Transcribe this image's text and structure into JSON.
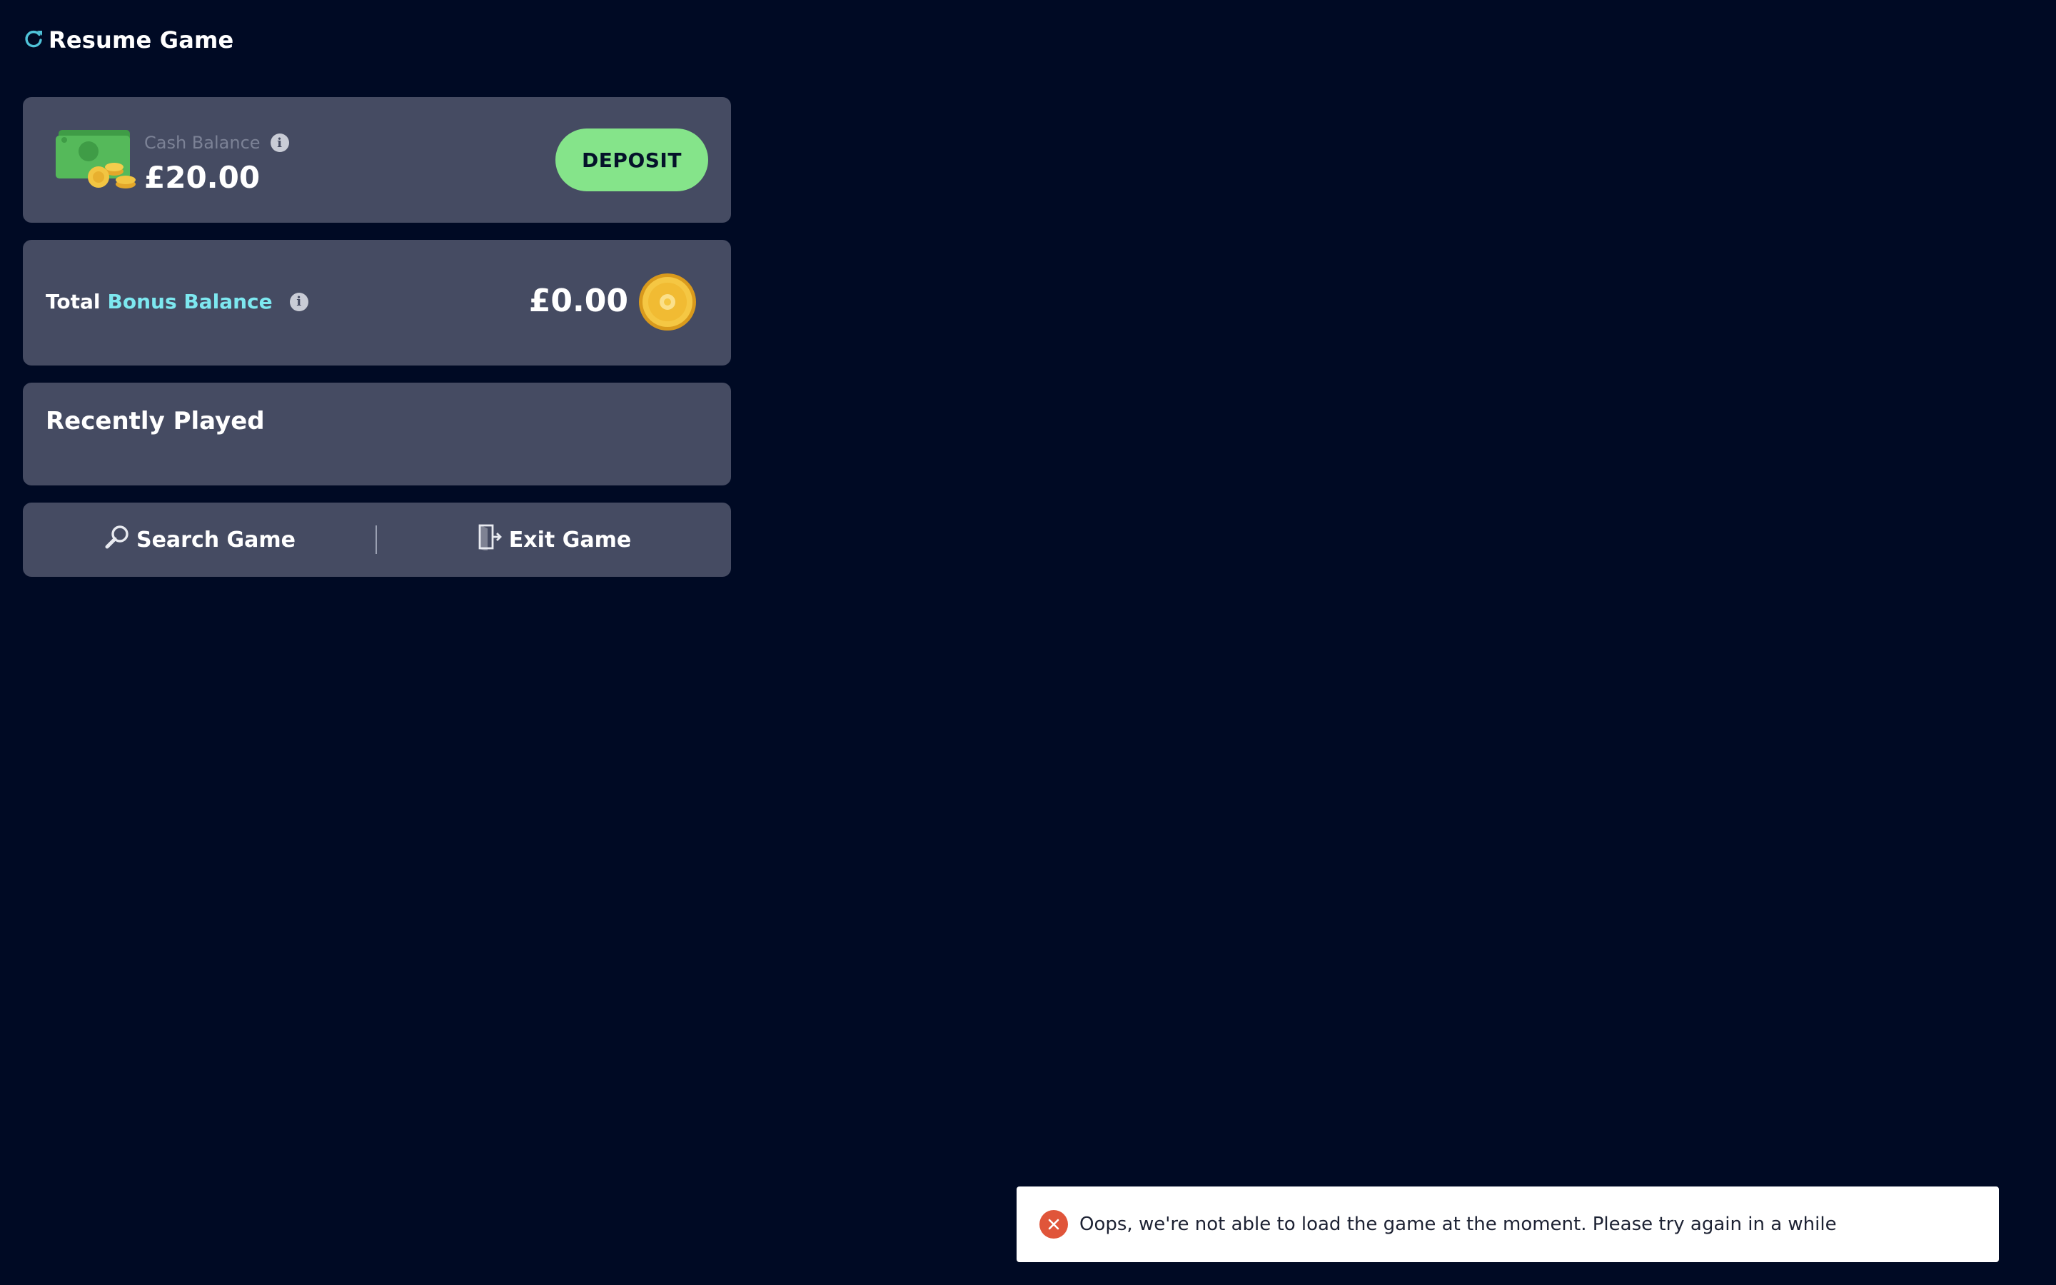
{
  "header": {
    "title": "Resume Game",
    "icon": "refresh-icon",
    "icon_color": "#4fc3d9"
  },
  "cash": {
    "label": "Cash Balance",
    "amount": "£20.00",
    "art": "cash-stack-icon",
    "info_icon": "info-icon",
    "deposit_label": "DEPOSIT",
    "deposit_color": "#85e48a"
  },
  "bonus": {
    "label_prefix": "Total",
    "label_accent": "Bonus Balance",
    "accent_color": "#7de8f0",
    "amount": "£0.00",
    "art": "gold-coin-icon",
    "info_icon": "info-icon"
  },
  "recent": {
    "title": "Recently Played"
  },
  "actions": {
    "search_label": "Search Game",
    "search_icon": "magnifier-icon",
    "exit_label": "Exit Game",
    "exit_icon": "exit-door-icon"
  },
  "toast": {
    "message": "Oops, we're not able to load the game at the moment. Please try again in a while",
    "icon": "error-icon",
    "icon_color": "#e0553a"
  },
  "theme": {
    "background": "#000a24",
    "panel": "#454b62"
  }
}
